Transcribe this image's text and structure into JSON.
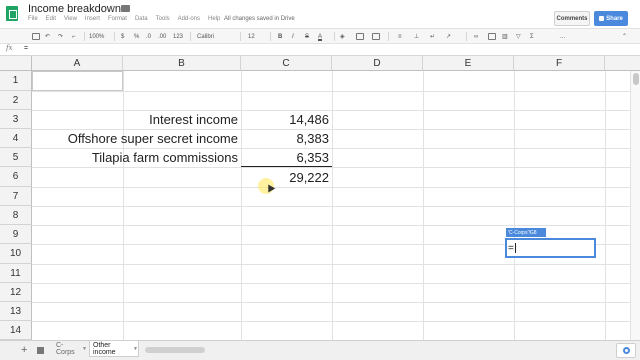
{
  "document": {
    "title": "Income breakdown",
    "save_status": "All changes saved in Drive"
  },
  "menu": [
    "File",
    "Edit",
    "View",
    "Insert",
    "Format",
    "Data",
    "Tools",
    "Add-ons",
    "Help"
  ],
  "header_buttons": {
    "comments": "Comments",
    "share": "Share"
  },
  "toolbar": {
    "zoom": "100%",
    "currency": "$",
    "percent": "%",
    "decrease_decimal": ".0",
    "increase_decimal": ".00",
    "more_formats": "123",
    "font": "Calibri",
    "font_size": "12",
    "bold": "B",
    "italic": "I",
    "strikethrough": "S",
    "text_color": "A",
    "more": "..."
  },
  "formula_bar": {
    "fx": "fx",
    "content": "="
  },
  "grid": {
    "columns": [
      "A",
      "B",
      "C",
      "D",
      "E",
      "F"
    ],
    "rows": [
      "1",
      "2",
      "3",
      "4",
      "5",
      "6",
      "7",
      "8",
      "9",
      "10",
      "11",
      "12",
      "13",
      "14"
    ],
    "labels": {
      "b3": "Interest income",
      "b4": "Offshore super secret income",
      "b5": "Tilapia farm commissions"
    },
    "values": {
      "c3": "14,486",
      "c4": "8,383",
      "c5": "6,353",
      "c6": "29,222"
    }
  },
  "editing": {
    "reference_tooltip": "'C-Corps'!G8",
    "cell_content": "="
  },
  "sheets": {
    "add": "+",
    "tabs": [
      "C-Corps",
      "Other income"
    ],
    "active_tab": "Other income"
  }
}
